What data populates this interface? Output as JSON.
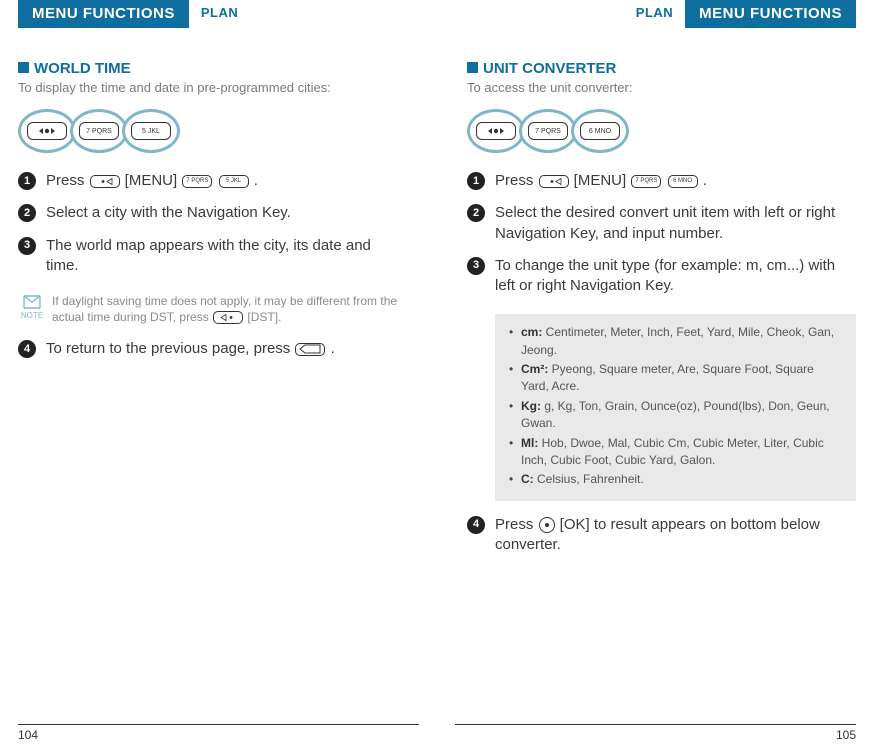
{
  "header": {
    "menu_functions": "MENU FUNCTIONS",
    "plan": "PLAN"
  },
  "left": {
    "title": "WORLD TIME",
    "subtitle": "To display the time and date in pre-programmed cities:",
    "keylabels": {
      "k2": "7 PQRS",
      "k3": "5 JKL"
    },
    "steps": {
      "s1_a": "Press ",
      "s1_b": " [MENU] ",
      "s1_c": " .",
      "s2": "Select a city with the Navigation Key.",
      "s3": "The world map appears with the city, its date and time.",
      "s4_a": "To return to the previous page, press ",
      "s4_b": " ."
    },
    "note": "If daylight saving time does not apply, it may be different from the actual time during DST, press ",
    "note_b": " [DST].",
    "note_label": "NOTE",
    "page_num": "104"
  },
  "right": {
    "title": "UNIT CONVERTER",
    "subtitle": "To access the unit converter:",
    "keylabels": {
      "k2": "7 PQRS",
      "k3": "6 MNO"
    },
    "steps": {
      "s1_a": "Press ",
      "s1_b": " [MENU] ",
      "s1_c": " .",
      "s2": "Select the desired convert unit item with left or right Navigation Key, and input number.",
      "s3": "To change the unit type (for example: m, cm...) with left or right Navigation Key.",
      "s4_a": "Press  ",
      "s4_b": "  [OK] to result appears on bottom below converter."
    },
    "units": {
      "cm_k": "cm:",
      "cm_v": " Centimeter, Meter, Inch, Feet, Yard, Mile, Cheok, Gan, Jeong.",
      "cm2_k": "Cm²:",
      "cm2_v": " Pyeong, Square meter, Are, Square Foot, Square Yard, Acre.",
      "kg_k": "Kg:",
      "kg_v": " g, Kg, Ton, Grain, Ounce(oz), Pound(lbs), Don, Geun, Gwan.",
      "ml_k": "Ml:",
      "ml_v": " Hob, Dwoe, Mal, Cubic Cm, Cubic Meter, Liter, Cubic Inch, Cubic Foot, Cubic Yard, Galon.",
      "c_k": "C:",
      "c_v": " Celsius, Fahrenheit."
    },
    "page_num": "105"
  }
}
